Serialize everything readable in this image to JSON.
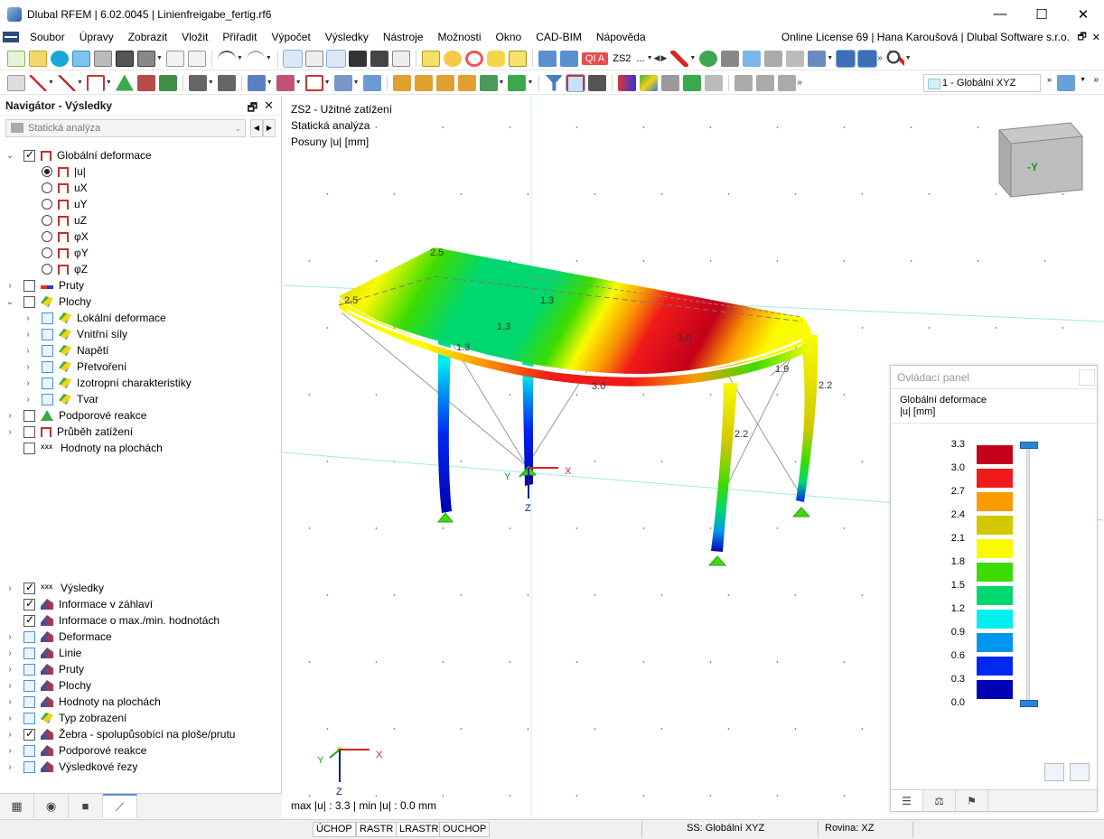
{
  "window": {
    "title": "Dlubal RFEM | 6.02.0045 | Linienfreigabe_fertig.rf6",
    "minimize": "—",
    "maximize": "☐",
    "close": "✕"
  },
  "menu": {
    "items": [
      "Soubor",
      "Úpravy",
      "Zobrazit",
      "Vložit",
      "Přiřadit",
      "Výpočet",
      "Výsledky",
      "Nástroje",
      "Možnosti",
      "Okno",
      "CAD-BIM",
      "Nápověda"
    ],
    "license": "Online License 69 | Hana Karoušová | Dlubal Software s.r.o.",
    "restore": "🗗",
    "close": "✕"
  },
  "toolbar": {
    "load_case_badge": "QI A",
    "load_case": "ZS2",
    "load_case_more": "...",
    "view_select": "1 - Globální XYZ"
  },
  "navigator": {
    "title": "Navigátor - Výsledky",
    "pin": "🗗",
    "close": "✕",
    "combo": "Statická analýza",
    "tree_top": [
      {
        "label": "Globální deformace",
        "level": 0,
        "expand": "⌄",
        "control": "checkbox",
        "checked": true,
        "icon": "frame"
      },
      {
        "label": "|u|",
        "level": 1,
        "control": "radio",
        "checked": true,
        "icon": "frame"
      },
      {
        "label": "uX",
        "level": 1,
        "control": "radio",
        "checked": false,
        "icon": "frame"
      },
      {
        "label": "uY",
        "level": 1,
        "control": "radio",
        "checked": false,
        "icon": "frame"
      },
      {
        "label": "uZ",
        "level": 1,
        "control": "radio",
        "checked": false,
        "icon": "frame"
      },
      {
        "label": "φX",
        "level": 1,
        "control": "radio",
        "checked": false,
        "icon": "frame"
      },
      {
        "label": "φY",
        "level": 1,
        "control": "radio",
        "checked": false,
        "icon": "frame"
      },
      {
        "label": "φZ",
        "level": 1,
        "control": "radio",
        "checked": false,
        "icon": "frame"
      },
      {
        "label": "Pruty",
        "level": 0,
        "expand": "›",
        "control": "checkbox",
        "checked": false,
        "icon": "beam"
      },
      {
        "label": "Plochy",
        "level": 0,
        "expand": "⌄",
        "control": "checkbox",
        "checked": false,
        "icon": "surface"
      },
      {
        "label": "Lokální deformace",
        "level": 1,
        "expand": "›",
        "control": "checkbox-blue",
        "checked": false,
        "icon": "surface"
      },
      {
        "label": "Vnitřní síly",
        "level": 1,
        "expand": "›",
        "control": "checkbox-blue",
        "checked": false,
        "icon": "surface"
      },
      {
        "label": "Napětí",
        "level": 1,
        "expand": "›",
        "control": "checkbox-blue",
        "checked": false,
        "icon": "surface"
      },
      {
        "label": "Přetvoření",
        "level": 1,
        "expand": "›",
        "control": "checkbox-blue",
        "checked": false,
        "icon": "surface"
      },
      {
        "label": "Izotropní charakteristiky",
        "level": 1,
        "expand": "›",
        "control": "checkbox-blue",
        "checked": false,
        "icon": "surface"
      },
      {
        "label": "Tvar",
        "level": 1,
        "expand": "›",
        "control": "checkbox-blue",
        "checked": false,
        "icon": "surface"
      },
      {
        "label": "Podporové reakce",
        "level": 0,
        "expand": "›",
        "control": "checkbox",
        "checked": false,
        "icon": "support"
      },
      {
        "label": "Průběh zatížení",
        "level": 0,
        "expand": "›",
        "control": "checkbox",
        "checked": false,
        "icon": "frame"
      },
      {
        "label": "Hodnoty na plochách",
        "level": 0,
        "control": "checkbox",
        "checked": false,
        "icon": "xxx"
      }
    ],
    "tree_bottom": [
      {
        "label": "Výsledky",
        "expand": "›",
        "control": "checkbox",
        "checked": true,
        "icon": "xxx"
      },
      {
        "label": "Informace v záhlaví",
        "control": "checkbox",
        "checked": true,
        "icon": "result"
      },
      {
        "label": "Informace o max./min. hodnotách",
        "control": "checkbox",
        "checked": true,
        "icon": "result"
      },
      {
        "label": "Deformace",
        "expand": "›",
        "control": "checkbox-blue",
        "checked": false,
        "icon": "result"
      },
      {
        "label": "Linie",
        "expand": "›",
        "control": "checkbox-blue",
        "checked": false,
        "icon": "result"
      },
      {
        "label": "Pruty",
        "expand": "›",
        "control": "checkbox-blue",
        "checked": false,
        "icon": "result"
      },
      {
        "label": "Plochy",
        "expand": "›",
        "control": "checkbox-blue",
        "checked": false,
        "icon": "result"
      },
      {
        "label": "Hodnoty na plochách",
        "expand": "›",
        "control": "checkbox-blue",
        "checked": false,
        "icon": "result"
      },
      {
        "label": "Typ zobrazení",
        "expand": "›",
        "control": "checkbox-blue",
        "checked": false,
        "icon": "surface"
      },
      {
        "label": "Žebra - spolupůsobící na ploše/prutu",
        "expand": "›",
        "control": "checkbox",
        "checked": true,
        "icon": "result"
      },
      {
        "label": "Podporové reakce",
        "expand": "›",
        "control": "checkbox-blue",
        "checked": false,
        "icon": "result"
      },
      {
        "label": "Výsledkové řezy",
        "expand": "›",
        "control": "checkbox-blue",
        "checked": false,
        "icon": "result"
      }
    ]
  },
  "viewport": {
    "info_lines": [
      "ZS2 - Užitné zatížení",
      "Statická analýza",
      "Posuny |u| [mm]"
    ],
    "max_min": "max |u| : 3.3 | min |u| : 0.0 mm",
    "view_cube_label": "-Y",
    "axes": {
      "x": "X",
      "y": "Y",
      "z": "Z"
    },
    "model_labels": [
      "2.5",
      "2.5",
      "1.3",
      "1.3",
      "1.3",
      "3.0",
      "3.0",
      "1.9",
      "2.2",
      "2.2"
    ]
  },
  "control_panel": {
    "title": "Ovládací panel",
    "heading": "Globální deformace",
    "unit": "|u| [mm]",
    "legend": [
      {
        "value": "3.3",
        "color": "#c4001a"
      },
      {
        "value": "3.0",
        "color": "#f01a1a"
      },
      {
        "value": "2.7",
        "color": "#fa9b00"
      },
      {
        "value": "2.4",
        "color": "#d2c800"
      },
      {
        "value": "2.1",
        "color": "#fafa00"
      },
      {
        "value": "1.8",
        "color": "#3cdc00"
      },
      {
        "value": "1.5",
        "color": "#00d76e"
      },
      {
        "value": "1.2",
        "color": "#00f0f0"
      },
      {
        "value": "0.9",
        "color": "#0096f0"
      },
      {
        "value": "0.6",
        "color": "#0028f0"
      },
      {
        "value": "0.3",
        "color": "#0000b4"
      },
      {
        "value": "0.0",
        "color": ""
      }
    ]
  },
  "statusbar": {
    "buttons": [
      "ÚCHOP",
      "RASTR",
      "LRASTR",
      "OUCHOP"
    ],
    "cs": "SS: Globální XYZ",
    "plane": "Rovina: XZ"
  }
}
